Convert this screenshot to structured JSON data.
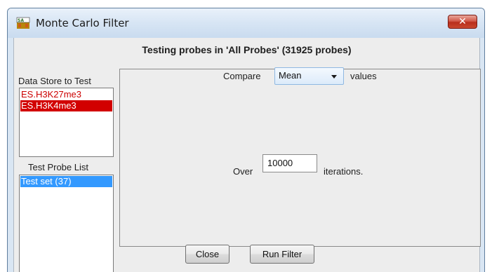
{
  "window": {
    "title": "Monte Carlo Filter",
    "icon": "app-logo-icon",
    "close_glyph": "✕"
  },
  "heading": "Testing probes in 'All Probes' (31925 probes)",
  "data_store": {
    "label": "Data Store to Test",
    "items": [
      {
        "label": "ES.H3K27me3",
        "selected": false
      },
      {
        "label": "ES.H3K4me3",
        "selected": true
      }
    ]
  },
  "test_probe_list": {
    "label": "Test Probe List",
    "items": [
      {
        "label": "Test set (37)",
        "selected": true
      }
    ]
  },
  "compare": {
    "prefix": "Compare",
    "selected": "Mean",
    "suffix": "values"
  },
  "iterations": {
    "prefix": "Over",
    "value": "10000",
    "suffix": "iterations."
  },
  "buttons": {
    "close": "Close",
    "run_filter": "Run Filter"
  },
  "colors": {
    "data_store_text": "#cc0000",
    "data_store_selected_bg": "#d20000",
    "probe_list_selected_bg": "#3399ff"
  }
}
